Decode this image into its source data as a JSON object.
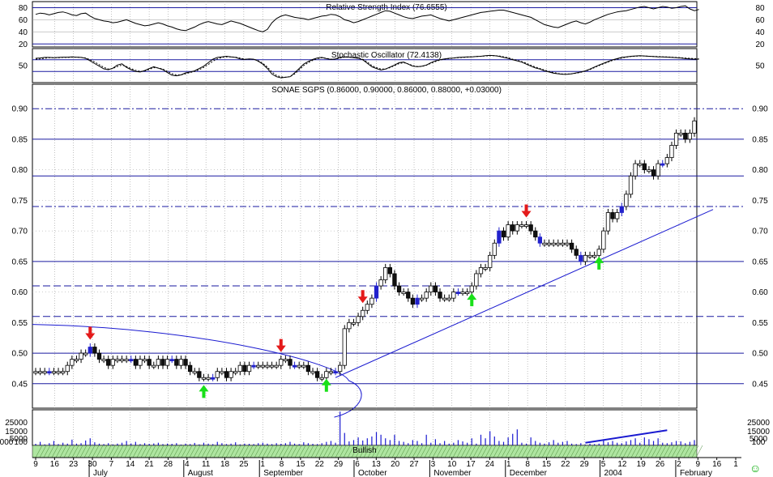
{
  "colors": {
    "background": "#ffffff",
    "panel_border": "#000000",
    "grid": "#9a9a9a",
    "level_line": "#1a1aa0",
    "trend_line": "#1a1ad0",
    "up_candle": "#ffffff",
    "down_candle": "#111111",
    "blue_bar": "#2222cc",
    "sell_arrow": "#e41a1a",
    "buy_arrow": "#19e019",
    "volume": "#1a1ad0",
    "bullish_fill": "#aee5a0"
  },
  "icons": {
    "sell_signal": "arrow-down",
    "buy_signal": "arrow-up",
    "footer": "smiley-icon"
  },
  "chart_data": {
    "type": "candlestick",
    "title": "SONAE SGPS (0.86000, 0.90000, 0.86000, 0.88000, +0.03000)",
    "ylim": [
      0.41,
      0.94
    ],
    "y_ticks": [
      "0.45",
      "0.50",
      "0.55",
      "0.60",
      "0.65",
      "0.70",
      "0.75",
      "0.80",
      "0.85",
      "0.90"
    ],
    "x_day_labels": [
      "9",
      "16",
      "23",
      "30",
      "7",
      "14",
      "21",
      "28",
      "4",
      "11",
      "18",
      "25",
      "1",
      "8",
      "15",
      "22",
      "29",
      "6",
      "13",
      "20",
      "27",
      "3",
      "10",
      "17",
      "24",
      "1",
      "8",
      "15",
      "22",
      "29",
      "5",
      "12",
      "19",
      "26",
      "2",
      "9",
      "16",
      "1"
    ],
    "x_month_labels": [
      "July",
      "August",
      "September",
      "October",
      "November",
      "December",
      "2004",
      "February"
    ],
    "closes": [
      0.47,
      0.47,
      0.47,
      0.47,
      0.47,
      0.47,
      0.47,
      0.48,
      0.49,
      0.49,
      0.5,
      0.5,
      0.51,
      0.5,
      0.49,
      0.49,
      0.48,
      0.49,
      0.49,
      0.49,
      0.49,
      0.49,
      0.48,
      0.49,
      0.49,
      0.48,
      0.48,
      0.49,
      0.48,
      0.49,
      0.49,
      0.48,
      0.49,
      0.48,
      0.47,
      0.47,
      0.46,
      0.46,
      0.46,
      0.46,
      0.47,
      0.47,
      0.46,
      0.47,
      0.47,
      0.48,
      0.47,
      0.48,
      0.48,
      0.48,
      0.48,
      0.48,
      0.48,
      0.48,
      0.49,
      0.49,
      0.48,
      0.48,
      0.48,
      0.48,
      0.47,
      0.47,
      0.46,
      0.46,
      0.47,
      0.47,
      0.47,
      0.48,
      0.54,
      0.55,
      0.55,
      0.56,
      0.57,
      0.58,
      0.59,
      0.61,
      0.62,
      0.64,
      0.63,
      0.61,
      0.6,
      0.6,
      0.59,
      0.58,
      0.59,
      0.59,
      0.6,
      0.61,
      0.6,
      0.59,
      0.59,
      0.59,
      0.6,
      0.6,
      0.6,
      0.6,
      0.61,
      0.63,
      0.64,
      0.64,
      0.66,
      0.68,
      0.7,
      0.69,
      0.71,
      0.7,
      0.71,
      0.71,
      0.71,
      0.7,
      0.69,
      0.68,
      0.68,
      0.68,
      0.68,
      0.68,
      0.68,
      0.68,
      0.67,
      0.66,
      0.65,
      0.66,
      0.66,
      0.66,
      0.67,
      0.7,
      0.73,
      0.72,
      0.73,
      0.74,
      0.76,
      0.79,
      0.81,
      0.81,
      0.8,
      0.8,
      0.79,
      0.81,
      0.81,
      0.82,
      0.84,
      0.86,
      0.86,
      0.85,
      0.86,
      0.88
    ],
    "level_lines": {
      "solid": [
        0.45,
        0.5,
        0.65,
        0.79,
        0.85
      ],
      "dash_dot": [
        0.74,
        0.9
      ],
      "dashed": [
        0.56,
        0.61
      ]
    },
    "trend_line": {
      "from": 0.46,
      "to": 0.735
    },
    "curve_line": {
      "from": 0.547,
      "to": 0.435
    },
    "sell_arrows": [
      "30",
      "15",
      "20",
      "1"
    ],
    "buy_arrows": [
      "11",
      "29",
      "10",
      "29"
    ],
    "rsi": {
      "title": "Relative Strength Index (76.6555)",
      "y_ticks": [
        "80",
        "60",
        "40",
        "20"
      ],
      "ylim": [
        15,
        90
      ],
      "values": [
        69,
        71,
        70,
        68,
        70,
        72,
        73,
        71,
        68,
        67,
        70,
        71,
        66,
        62,
        60,
        58,
        57,
        55,
        56,
        58,
        60,
        57,
        54,
        52,
        50,
        51,
        53,
        55,
        53,
        50,
        48,
        45,
        43,
        42,
        45,
        48,
        52,
        55,
        57,
        55,
        53,
        52,
        55,
        58,
        56,
        54,
        51,
        48,
        45,
        42,
        40,
        44,
        55,
        62,
        66,
        68,
        66,
        64,
        63,
        62,
        60,
        62,
        64,
        66,
        67,
        69,
        68,
        65,
        60,
        58,
        55,
        57,
        60,
        63,
        66,
        69,
        72,
        75,
        74,
        71,
        68,
        65,
        63,
        62,
        64,
        66,
        67,
        68,
        65,
        62,
        60,
        58,
        60,
        62,
        64,
        66,
        68,
        70,
        72,
        73,
        74,
        75,
        76,
        76,
        74,
        72,
        70,
        68,
        66,
        64,
        60,
        56,
        52,
        50,
        48,
        47,
        50,
        53,
        56,
        58,
        55,
        53,
        56,
        60,
        63,
        66,
        69,
        71,
        73,
        74,
        75,
        77,
        79,
        81,
        82,
        80,
        78,
        80,
        82,
        81,
        79,
        80,
        82,
        83,
        78,
        75,
        77
      ]
    },
    "stochastic": {
      "title": "Stochastic Oscillator (72.4138)",
      "y_ticks": [
        "50"
      ],
      "ylim": [
        0,
        100
      ],
      "k": [
        75,
        76,
        78,
        78,
        77,
        78,
        79,
        79,
        80,
        79,
        78,
        75,
        66,
        57,
        48,
        39,
        36,
        41,
        52,
        56,
        44,
        36,
        30,
        28,
        33,
        40,
        46,
        41,
        36,
        26,
        17,
        15,
        18,
        25,
        28,
        32,
        40,
        48,
        60,
        72,
        78,
        80,
        82,
        80,
        78,
        73,
        71,
        73,
        72,
        65,
        55,
        40,
        21,
        12,
        8,
        10,
        12,
        25,
        40,
        55,
        64,
        71,
        76,
        78,
        74,
        71,
        73,
        78,
        80,
        79,
        77,
        75,
        70,
        58,
        46,
        40,
        35,
        38,
        45,
        52,
        60,
        62,
        55,
        48,
        46,
        48,
        52,
        60,
        66,
        70,
        73,
        75,
        76,
        78,
        79,
        80,
        80,
        81,
        82,
        84,
        85,
        84,
        82,
        78,
        75,
        70,
        66,
        62,
        55,
        48,
        42,
        38,
        32,
        28,
        24,
        22,
        20,
        20,
        22,
        25,
        28,
        32,
        38,
        45,
        52,
        58,
        64,
        70,
        74,
        78,
        80,
        82,
        83,
        84,
        83,
        82,
        81,
        80,
        80,
        79,
        78,
        77,
        76,
        74,
        73,
        72,
        72
      ],
      "d": [
        72,
        73,
        75,
        77,
        77,
        77,
        78,
        78,
        79,
        79,
        78,
        76,
        70,
        62,
        53,
        44,
        38,
        40,
        47,
        52,
        47,
        40,
        34,
        30,
        31,
        37,
        43,
        42,
        38,
        30,
        22,
        18,
        18,
        22,
        26,
        30,
        36,
        44,
        54,
        65,
        73,
        78,
        80,
        80,
        79,
        76,
        72,
        72,
        72,
        67,
        58,
        45,
        28,
        16,
        11,
        10,
        12,
        21,
        35,
        50,
        60,
        68,
        74,
        77,
        75,
        72,
        72,
        76,
        79,
        79,
        78,
        76,
        72,
        62,
        50,
        43,
        38,
        38,
        43,
        50,
        57,
        60,
        56,
        50,
        47,
        47,
        51,
        58,
        64,
        69,
        72,
        74,
        76,
        77,
        78,
        79,
        80,
        81,
        82,
        83,
        84,
        84,
        83,
        80,
        77,
        72,
        68,
        64,
        58,
        51,
        45,
        40,
        35,
        30,
        26,
        23,
        21,
        21,
        22,
        24,
        27,
        31,
        36,
        43,
        50,
        56,
        62,
        68,
        72,
        76,
        79,
        81,
        82,
        83,
        83,
        82,
        81,
        81,
        80,
        80,
        79,
        78,
        77,
        76,
        75,
        74,
        73
      ]
    },
    "volume": {
      "y_ticks": [
        "25000",
        "15000",
        "5000",
        "100",
        "000"
      ],
      "y_ticks_right": [
        "25000",
        "15000",
        "5000",
        "100",
        "100"
      ],
      "ylim": [
        0,
        40000
      ],
      "values": [
        1800,
        4000,
        1200,
        2500,
        5000,
        1500,
        3000,
        2000,
        6500,
        2000,
        2500,
        5500,
        8000,
        3500,
        2000,
        1500,
        2500,
        1200,
        2000,
        3000,
        5000,
        2200,
        4000,
        1500,
        2500,
        1800,
        2200,
        3000,
        1500,
        2000,
        1800,
        2500,
        1000,
        2000,
        1500,
        2800,
        1200,
        3000,
        2000,
        1500,
        4000,
        2500,
        1500,
        2000,
        3500,
        1200,
        2000,
        1800,
        1500,
        2500,
        3000,
        2000,
        1500,
        2500,
        1800,
        2500,
        4000,
        2000,
        1500,
        3500,
        2500,
        1800,
        1500,
        2500,
        4000,
        5000,
        3000,
        38000,
        14000,
        4500,
        6000,
        9000,
        5500,
        8000,
        10000,
        15000,
        12000,
        8000,
        6000,
        12000,
        5000,
        4000,
        2500,
        6000,
        5000,
        2500,
        12000,
        3000,
        7000,
        2500,
        5000,
        2000,
        3000,
        6000,
        4500,
        3000,
        8000,
        2000,
        12000,
        8000,
        16000,
        10000,
        5000,
        4000,
        9000,
        13000,
        18000,
        3000,
        2000,
        9000,
        5000,
        3000,
        2000,
        3500,
        6000,
        3000,
        4000,
        5000,
        2000,
        1500,
        2500,
        1000,
        2000,
        1500,
        2000,
        6000,
        3500,
        5000,
        3000,
        2500,
        4500,
        6000,
        8000,
        3000,
        9000,
        7000,
        5000,
        8000,
        3000,
        2500,
        3500,
        5000,
        4500,
        2500,
        4000,
        6000
      ],
      "bullish_label": "Bullish",
      "trend_from": 3000,
      "trend_to": 17000
    }
  },
  "footer_glyph": "☺"
}
